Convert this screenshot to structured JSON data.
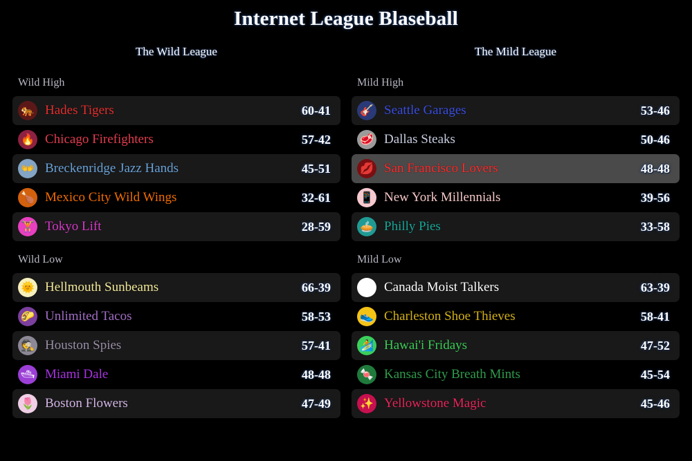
{
  "title": "Internet League Blaseball",
  "leagues": [
    {
      "name": "The Wild League",
      "subleagues": [
        {
          "name": "Wild High",
          "teams": [
            {
              "name": "Hades Tigers",
              "record": "60-41",
              "color": "#e42f2f",
              "emblem_icon": "tiger-icon",
              "emblem": "🐅",
              "badge": "#5c1818",
              "striped": true,
              "hovered": false
            },
            {
              "name": "Chicago Firefighters",
              "record": "57-42",
              "color": "#e23b4e",
              "emblem_icon": "fire-icon",
              "emblem": "🔥",
              "badge": "#8d2141",
              "striped": false,
              "hovered": false
            },
            {
              "name": "Breckenridge Jazz Hands",
              "record": "45-51",
              "color": "#6aa2d8",
              "emblem_icon": "open-hands-icon",
              "emblem": "👐",
              "badge": "#83a4c4",
              "striped": true,
              "hovered": false
            },
            {
              "name": "Mexico City Wild Wings",
              "record": "32-61",
              "color": "#f06b00",
              "emblem_icon": "poultry-leg-icon",
              "emblem": "🍗",
              "badge": "#d2600d",
              "striped": false,
              "hovered": false
            },
            {
              "name": "Tokyo Lift",
              "record": "28-59",
              "color": "#d73ac9",
              "emblem_icon": "weightlifter-icon",
              "emblem": "🏋",
              "badge": "#e93fc0",
              "striped": true,
              "hovered": false
            }
          ]
        },
        {
          "name": "Wild Low",
          "teams": [
            {
              "name": "Hellmouth Sunbeams",
              "record": "66-39",
              "color": "#f3e99a",
              "emblem_icon": "sun-with-face-icon",
              "emblem": "🌞",
              "badge": "#f7f0bd",
              "striped": true,
              "hovered": false
            },
            {
              "name": "Unlimited Tacos",
              "record": "58-53",
              "color": "#a16dc3",
              "emblem_icon": "taco-icon",
              "emblem": "🌮",
              "badge": "#7b3f9e",
              "striped": false,
              "hovered": false
            },
            {
              "name": "Houston Spies",
              "record": "57-41",
              "color": "#9a8fa8",
              "emblem_icon": "detective-icon",
              "emblem": "🕵",
              "badge": "#8d8896",
              "striped": true,
              "hovered": false
            },
            {
              "name": "Miami Dale",
              "record": "48-48",
              "color": "#a832e0",
              "emblem_icon": "speedboat-icon",
              "emblem": "🛥",
              "badge": "#9b3fd6",
              "striped": false,
              "hovered": false
            },
            {
              "name": "Boston Flowers",
              "record": "47-49",
              "color": "#d5b8e8",
              "emblem_icon": "tulip-icon",
              "emblem": "🌷",
              "badge": "#f0cfe6",
              "striped": true,
              "hovered": false
            }
          ]
        }
      ]
    },
    {
      "name": "The Mild League",
      "subleagues": [
        {
          "name": "Mild High",
          "teams": [
            {
              "name": "Seattle Garages",
              "record": "53-46",
              "color": "#3b4ee0",
              "emblem_icon": "guitar-icon",
              "emblem": "🎸",
              "badge": "#2a3a78",
              "striped": true,
              "hovered": false
            },
            {
              "name": "Dallas Steaks",
              "record": "50-46",
              "color": "#c7cde0",
              "emblem_icon": "cut-of-meat-icon",
              "emblem": "🥩",
              "badge": "#9b9b9b",
              "striped": false,
              "hovered": false
            },
            {
              "name": "San Francisco Lovers",
              "record": "48-48",
              "color": "#ff2d2d",
              "emblem_icon": "kiss-mark-icon",
              "emblem": "💋",
              "badge": "#7a0f12",
              "striped": true,
              "hovered": true
            },
            {
              "name": "New York Millennials",
              "record": "39-56",
              "color": "#f5c6c6",
              "emblem_icon": "mobile-phone-icon",
              "emblem": "📱",
              "badge": "#f6c9cf",
              "striped": false,
              "hovered": false
            },
            {
              "name": "Philly Pies",
              "record": "33-58",
              "color": "#17a798",
              "emblem_icon": "pie-icon",
              "emblem": "🥧",
              "badge": "#1f9b94",
              "striped": true,
              "hovered": false
            }
          ]
        },
        {
          "name": "Mild Low",
          "teams": [
            {
              "name": "Canada Moist Talkers",
              "record": "63-39",
              "color": "#ffffff",
              "emblem_icon": "white-circle-icon",
              "emblem": "⚪",
              "badge": "#ffffff",
              "striped": true,
              "hovered": false
            },
            {
              "name": "Charleston Shoe Thieves",
              "record": "58-41",
              "color": "#d4b016",
              "emblem_icon": "running-shoe-icon",
              "emblem": "👟",
              "badge": "#f5c316",
              "striped": false,
              "hovered": false
            },
            {
              "name": "Hawai'i Fridays",
              "record": "47-52",
              "color": "#3ccd57",
              "emblem_icon": "surfing-icon",
              "emblem": "🏄",
              "badge": "#3bcf5c",
              "striped": true,
              "hovered": false
            },
            {
              "name": "Kansas City Breath Mints",
              "record": "45-54",
              "color": "#2f9b4b",
              "emblem_icon": "candy-icon",
              "emblem": "🍬",
              "badge": "#1f7a3c",
              "striped": false,
              "hovered": false
            },
            {
              "name": "Yellowstone Magic",
              "record": "45-46",
              "color": "#e8265c",
              "emblem_icon": "sparkles-icon",
              "emblem": "✨",
              "badge": "#c7104f",
              "striped": true,
              "hovered": false
            }
          ]
        }
      ]
    }
  ]
}
